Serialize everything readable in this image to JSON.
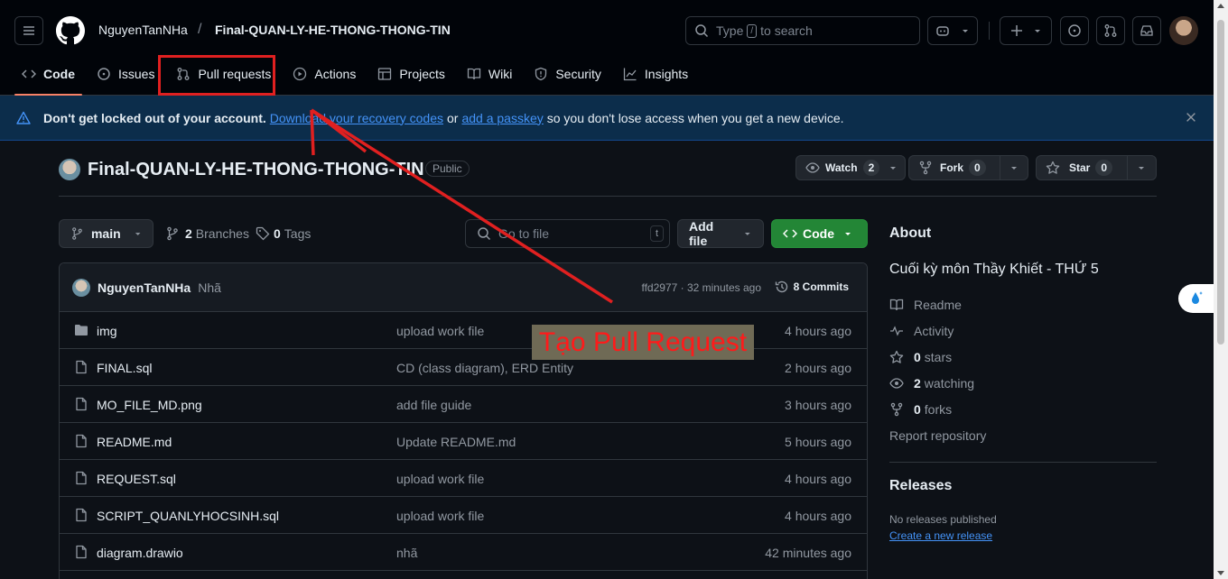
{
  "header": {
    "owner": "NguyenTanNHa",
    "slash": "/",
    "repo": "Final-QUAN-LY-HE-THONG-THONG-TIN",
    "search_prefix": "Type",
    "search_key": "/",
    "search_suffix": "to search"
  },
  "tabs": [
    {
      "label": "Code",
      "icon": "code-icon"
    },
    {
      "label": "Issues",
      "icon": "issue-icon"
    },
    {
      "label": "Pull requests",
      "icon": "pull-request-icon"
    },
    {
      "label": "Actions",
      "icon": "play-icon"
    },
    {
      "label": "Projects",
      "icon": "table-icon"
    },
    {
      "label": "Wiki",
      "icon": "book-icon"
    },
    {
      "label": "Security",
      "icon": "shield-icon"
    },
    {
      "label": "Insights",
      "icon": "graph-icon"
    }
  ],
  "banner": {
    "bold": "Don't get locked out of your account.",
    "link1": "Download your recovery codes",
    "or": "or",
    "link2": "add a passkey",
    "rest": "so you don't lose access when you get a new device."
  },
  "repo": {
    "title": "Final-QUAN-LY-HE-THONG-THONG-TIN",
    "visibility": "Public",
    "watch_label": "Watch",
    "watch_count": "2",
    "fork_label": "Fork",
    "fork_count": "0",
    "star_label": "Star",
    "star_count": "0"
  },
  "toolbar": {
    "branch": "main",
    "branches_count": "2",
    "branches_label": "Branches",
    "tags_count": "0",
    "tags_label": "Tags",
    "goto_placeholder": "Go to file",
    "goto_key": "t",
    "add_file": "Add file",
    "code": "Code"
  },
  "latest_commit": {
    "author": "NguyenTanNHa",
    "message": "Nhã",
    "meta": "ffd2977 · 32 minutes ago",
    "commits_count": "8 Commits"
  },
  "files": [
    {
      "name": "img",
      "type": "folder",
      "message": "upload work file",
      "time": "4 hours ago"
    },
    {
      "name": "FINAL.sql",
      "type": "file",
      "message": "CD (class diagram), ERD Entity",
      "time": "2 hours ago"
    },
    {
      "name": "MO_FILE_MD.png",
      "type": "file",
      "message": "add file guide",
      "time": "3 hours ago"
    },
    {
      "name": "README.md",
      "type": "file",
      "message": "Update README.md",
      "time": "5 hours ago"
    },
    {
      "name": "REQUEST.sql",
      "type": "file",
      "message": "upload work file",
      "time": "4 hours ago"
    },
    {
      "name": "SCRIPT_QUANLYHOCSINH.sql",
      "type": "file",
      "message": "upload work file",
      "time": "4 hours ago"
    },
    {
      "name": "diagram.drawio",
      "type": "file",
      "message": "nhã",
      "time": "42 minutes ago"
    }
  ],
  "about": {
    "title": "About",
    "description": "Cuối kỳ môn Thầy Khiết - THỨ 5",
    "readme": "Readme",
    "activity": "Activity",
    "stars_count": "0",
    "stars_label": "stars",
    "watching_count": "2",
    "watching_label": "watching",
    "forks_count": "0",
    "forks_label": "forks",
    "report": "Report repository"
  },
  "releases": {
    "title": "Releases",
    "none": "No releases published",
    "create": "Create a new release"
  },
  "annotation": {
    "label": "Tạo Pull Request",
    "color": "#e02020"
  },
  "colors": {
    "accent_tab": "#f78166",
    "code_button": "#238636",
    "link": "#4493f8"
  }
}
